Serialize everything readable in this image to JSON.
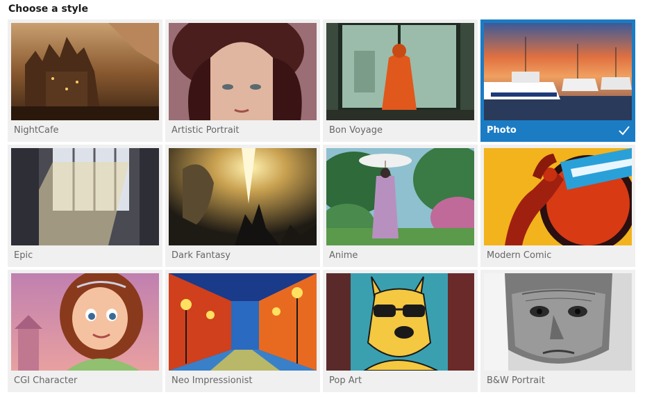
{
  "header": {
    "title": "Choose a style"
  },
  "styles": [
    {
      "label": "NightCafe",
      "selected": false
    },
    {
      "label": "Artistic Portrait",
      "selected": false
    },
    {
      "label": "Bon Voyage",
      "selected": false
    },
    {
      "label": "Photo",
      "selected": true
    },
    {
      "label": "Epic",
      "selected": false
    },
    {
      "label": "Dark Fantasy",
      "selected": false
    },
    {
      "label": "Anime",
      "selected": false
    },
    {
      "label": "Modern Comic",
      "selected": false
    },
    {
      "label": "CGI Character",
      "selected": false
    },
    {
      "label": "Neo Impressionist",
      "selected": false
    },
    {
      "label": "Pop Art",
      "selected": false
    },
    {
      "label": "B&W Portrait",
      "selected": false
    }
  ],
  "colors": {
    "selected_accent": "#1b7cc4",
    "card_bg": "#f0f0f0",
    "label_text": "#666666"
  },
  "icons": {
    "selected_indicator": "checkmark-icon"
  }
}
